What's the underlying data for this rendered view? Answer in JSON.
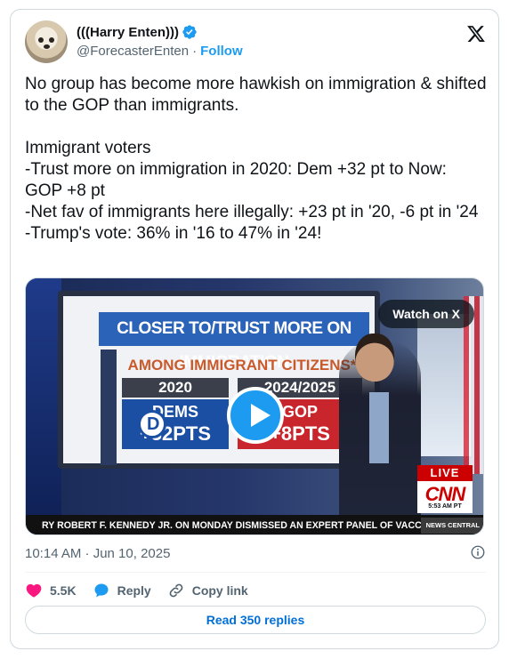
{
  "author": {
    "display_name": "(((Harry Enten)))",
    "handle": "@ForecasterEnten",
    "separator": "·",
    "follow_label": "Follow"
  },
  "tweet": {
    "text": "No group has become more hawkish on immigration & shifted to the GOP than immigrants.\n\nImmigrant voters\n-Trust more on immigration in 2020: Dem +32 pt to Now: GOP +8 pt\n-Net fav of immigrants here illegally: +23 pt in '20, -6 pt in '24\n-Trump's vote: 36% in '16 to 47% in '24!"
  },
  "media": {
    "watch_label": "Watch on X",
    "screen_title": "CLOSER TO/TRUST MORE ON IMMIGRATION",
    "screen_subtitle": "AMONG IMMIGRANT CITIZENS*",
    "col_2020": "2020",
    "col_2024": "2024/2025",
    "dem_label": "DEMS",
    "dem_value": "+32PTS",
    "gop_label": "GOP",
    "gop_value": "+8PTS",
    "live_label": "LIVE",
    "network": "CNN",
    "network_time": "5:53 AM PT",
    "ticker": "RY ROBERT F. KENNEDY JR. ON MONDAY DISMISSED AN EXPERT PANEL OF VACCINE A",
    "ticker_tag": "NEWS CENTRAL"
  },
  "meta": {
    "timestamp": "10:14 AM · Jun 10, 2025"
  },
  "actions": {
    "likes": "5.5K",
    "reply_label": "Reply",
    "copy_label": "Copy link"
  },
  "replies_button": "Read 350 replies",
  "colors": {
    "accent": "#1d9bf0",
    "like": "#f91880",
    "text_secondary": "#536471"
  }
}
